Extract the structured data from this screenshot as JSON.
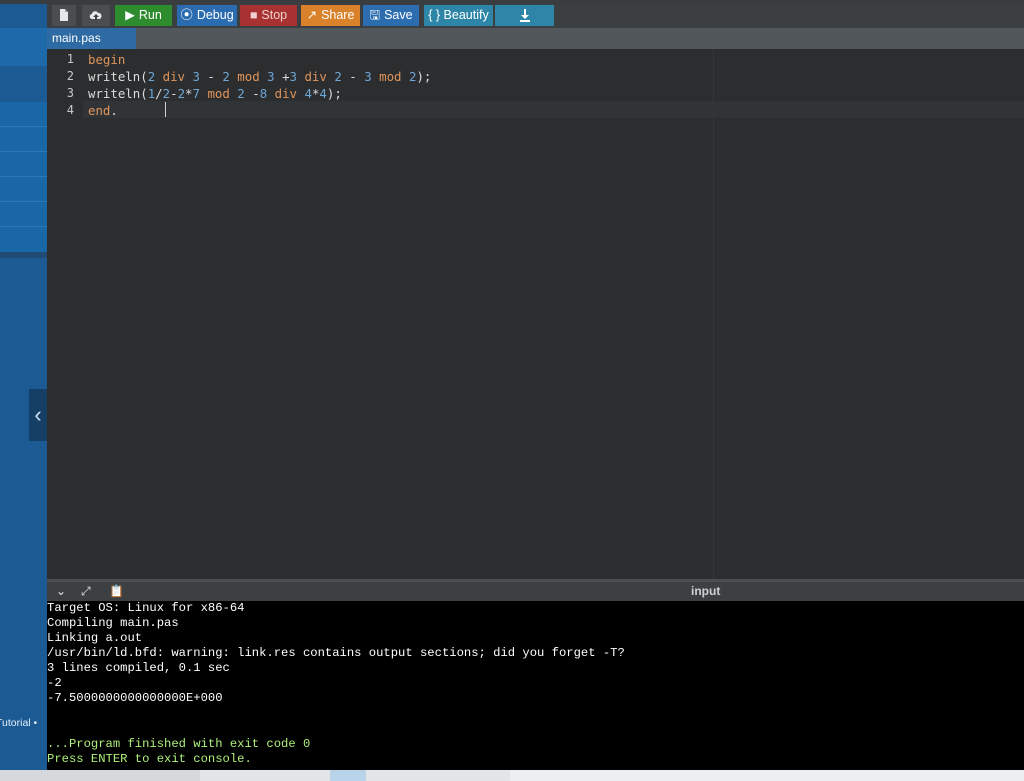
{
  "toolbar": {
    "new_file_icon": "file-icon",
    "upload_icon": "cloud-upload-icon",
    "run_label": "Run",
    "debug_label": "Debug",
    "stop_label": "Stop",
    "share_label": "Share",
    "save_label": "Save",
    "beautify_label": "{ } Beautify",
    "download_icon": "download-icon",
    "colors": {
      "run": "#2e8b2e",
      "debug": "#2b6cb0",
      "stop": "#a83232",
      "share": "#d9822b",
      "save": "#2c6db0",
      "beautify": "#2d86a8",
      "download": "#2d86a8"
    }
  },
  "tabs": [
    {
      "label": "main.pas",
      "active": true
    }
  ],
  "editor": {
    "line_numbers": [
      "1",
      "2",
      "3",
      "4"
    ],
    "lines": [
      "begin",
      "writeln(2 div 3 - 2 mod 3 +3 div 2 - 3 mod 2);",
      "writeln(1/2-2*7 mod 2 -8 div 4*4);",
      "end."
    ]
  },
  "console": {
    "input_label": "input",
    "lines": [
      "Target OS: Linux for x86-64",
      "Compiling main.pas",
      "Linking a.out",
      "/usr/bin/ld.bfd: warning: link.res contains output sections; did you forget -T?",
      "3 lines compiled, 0.1 sec",
      "-2",
      "-7.5000000000000000E+000",
      "",
      "",
      "...Program finished with exit code 0",
      "Press ENTER to exit console."
    ]
  },
  "sidebar": {
    "tutorial_link": "Tutorial •"
  }
}
